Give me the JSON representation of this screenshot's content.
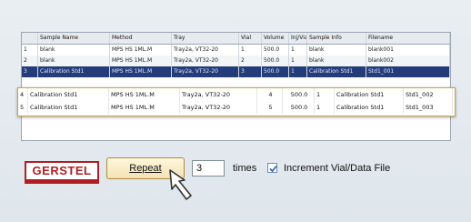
{
  "table": {
    "headers": [
      "",
      "Sample Name",
      "Method",
      "Tray",
      "Vial",
      "Volume",
      "Inj/Vial",
      "Sample Info",
      "Filename"
    ],
    "rows": [
      [
        "1",
        "blank",
        "MPS HS 1ML.M",
        "Tray2a, VT32-20",
        "1",
        "500.0",
        "1",
        "blank",
        "blank001"
      ],
      [
        "2",
        "blank",
        "MPS HS 1ML.M",
        "Tray2a, VT32-20",
        "2",
        "500.0",
        "1",
        "blank",
        "blank002"
      ],
      [
        "3",
        "Calibration Std1",
        "MPS HS 1ML.M",
        "Tray2a, VT32-20",
        "3",
        "500.0",
        "1",
        "Calibration Std1",
        "Std1_001"
      ]
    ]
  },
  "popup_rows": [
    [
      "4",
      "Calibration Std1",
      "MPS HS 1ML.M",
      "Tray2a, VT32-20",
      "4",
      "500.0",
      "1",
      "Calibration Std1",
      "Std1_002"
    ],
    [
      "5",
      "Calibration Std1",
      "MPS HS 1ML.M",
      "Tray2a, VT32-20",
      "5",
      "500.0",
      "1",
      "Calibration Std1",
      "Std1_003"
    ]
  ],
  "logo_text": "GERSTEL",
  "repeat_label": "Repeat",
  "repeat_count": "3",
  "times_label": "times",
  "increment_label": "Increment Vial/Data File",
  "increment_checked": true,
  "colors": {
    "accent": "#243d7a",
    "logo": "#b01e23",
    "button": "#f3e2b3"
  }
}
